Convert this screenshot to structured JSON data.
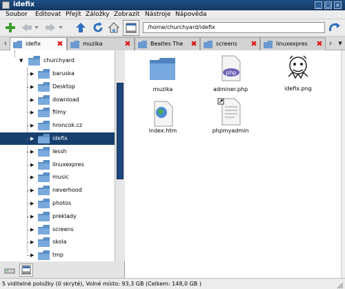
{
  "window": {
    "title": "idefix",
    "controls": [
      "_",
      "□",
      "×"
    ]
  },
  "menubar": {
    "items": [
      {
        "label": "Soubor"
      },
      {
        "label": "Editovat"
      },
      {
        "label": "Přejít"
      },
      {
        "label": "Záložky"
      },
      {
        "label": "Zobrazit"
      },
      {
        "label": "Nástroje"
      },
      {
        "label": "Nápověda"
      }
    ]
  },
  "toolbar": {
    "buttons": [
      "new-tab-icon",
      "back-icon",
      "forward-icon",
      "up-icon",
      "reload-icon",
      "home-icon",
      "location-bar-toggle-icon",
      "go-icon"
    ],
    "location": "/home/churchyard/idefix"
  },
  "tabs": [
    {
      "label": "idefix",
      "active": true
    },
    {
      "label": "muzika",
      "active": false
    },
    {
      "label": "Beatles The",
      "active": false
    },
    {
      "label": "screens",
      "active": false
    },
    {
      "label": "linuxexpres",
      "active": false
    }
  ],
  "tree": {
    "root": "churchyard",
    "items": [
      {
        "label": "baruska"
      },
      {
        "label": "Desktop"
      },
      {
        "label": "download"
      },
      {
        "label": "filmy"
      },
      {
        "label": "hroncok.cz"
      },
      {
        "label": "idefix",
        "selected": true
      },
      {
        "label": "lessh"
      },
      {
        "label": "linuxexpres"
      },
      {
        "label": "music"
      },
      {
        "label": "neverhood"
      },
      {
        "label": "photos"
      },
      {
        "label": "preklady"
      },
      {
        "label": "screens"
      },
      {
        "label": "skola"
      },
      {
        "label": "tmp"
      }
    ]
  },
  "files": [
    {
      "name": "muzika",
      "type": "folder"
    },
    {
      "name": "adminer.php",
      "type": "php"
    },
    {
      "name": "idefix.png",
      "type": "image"
    },
    {
      "name": "index.htm",
      "type": "html"
    },
    {
      "name": "phpmyadmin",
      "type": "symlink-text"
    }
  ],
  "status": "5 viditelné položky (0 skryté), Volné místo: 93,3 GB (Celkem: 148,0 GB )",
  "colors": {
    "selection": "#173f6e",
    "titlebar": "#1f4f86",
    "folder": "#5b8fc7",
    "close": "#d11111"
  }
}
